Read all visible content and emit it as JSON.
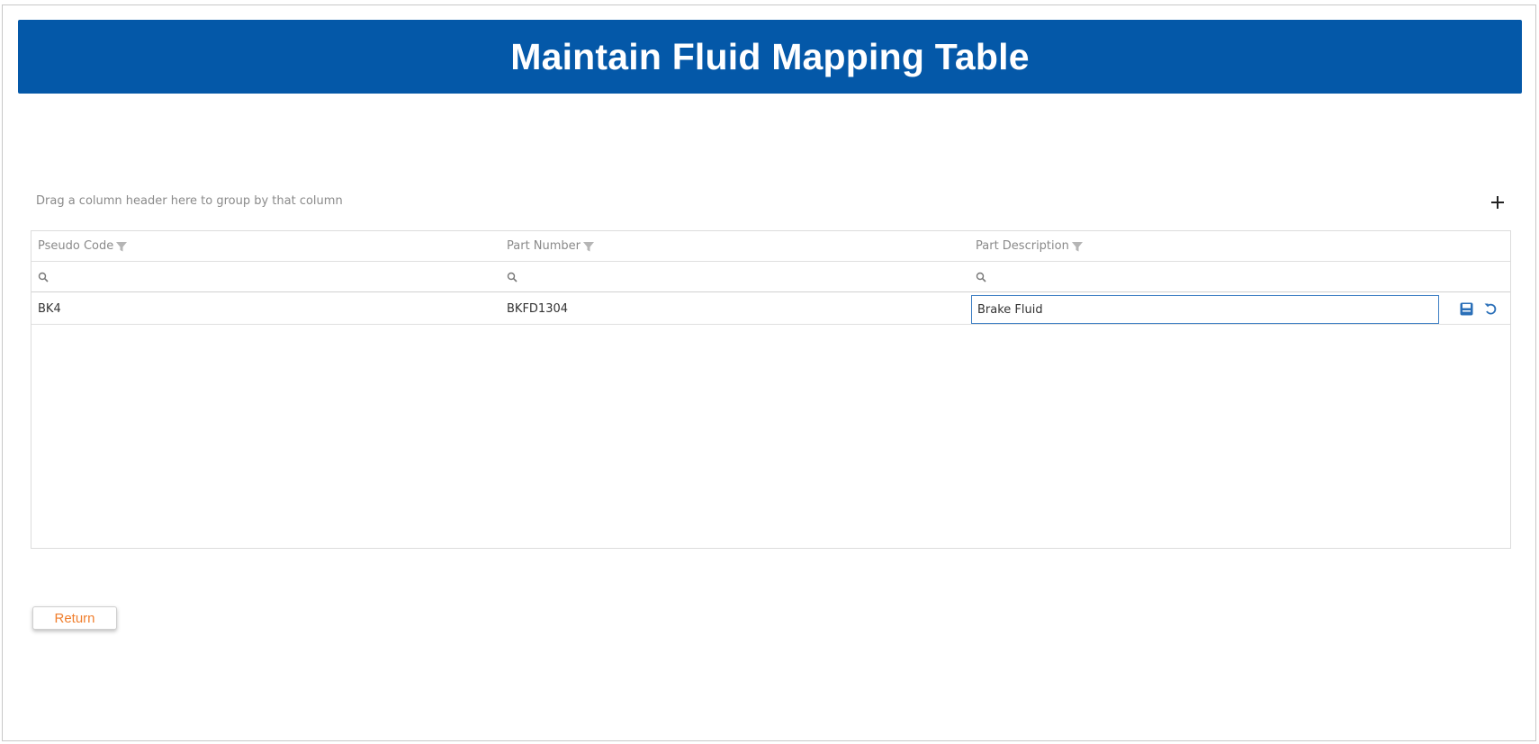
{
  "page": {
    "title": "Maintain Fluid Mapping Table"
  },
  "grid": {
    "group_panel_text": "Drag a column header here to group by that column",
    "columns": [
      {
        "label": "Pseudo Code"
      },
      {
        "label": "Part Number"
      },
      {
        "label": "Part Description"
      }
    ],
    "rows": [
      {
        "pseudo_code": "BK4",
        "part_number": "BKFD1304",
        "part_description": "Brake Fluid"
      }
    ]
  },
  "actions": {
    "return_label": "Return"
  },
  "icons": {
    "add": "plus-icon",
    "filter": "funnel-icon",
    "search": "search-icon",
    "save": "save-icon",
    "undo": "undo-icon"
  },
  "colors": {
    "header_bg": "#0458a8",
    "header_text": "#ffffff",
    "accent_icon": "#2a6fb8",
    "return_text": "#f07f2e",
    "edit_border": "#3d7fc4"
  }
}
